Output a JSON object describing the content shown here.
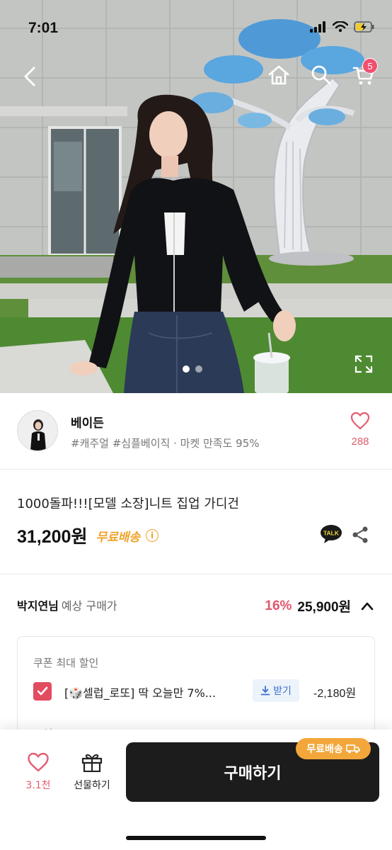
{
  "status_bar": {
    "time": "7:01"
  },
  "header": {
    "back_icon": "chevron-left-icon",
    "home_icon": "home-icon",
    "search_icon": "search-icon",
    "cart_icon": "cart-icon",
    "cart_badge": "5"
  },
  "hero": {
    "slide_count": 2,
    "active_slide": 1,
    "expand_icon": "expand-icon"
  },
  "seller": {
    "name": "베이든",
    "meta": "#캐주얼 #심플베이직 · 마켓 만족도 95%",
    "like_count": "288"
  },
  "product": {
    "title": "1000돌파!!![모델 소장]니트 집업 가디건",
    "price": "31,200원",
    "free_shipping": "무료배송",
    "talk_icon": "talk-icon",
    "share_icon": "share-icon"
  },
  "expected": {
    "buyer_name": "박지연님",
    "label": "예상 구매가",
    "discount": "16%",
    "final_price": "25,900원"
  },
  "coupon": {
    "heading": "쿠폰 최대 할인",
    "name": "[🎲셀럽_로또] 딱 오늘만 7%...",
    "get_label": "받기",
    "amount": "-2,180원",
    "point_heading": "포인트"
  },
  "bottom_bar": {
    "like_count": "3.1천",
    "gift_label": "선물하기",
    "buy_label": "구매하기",
    "ship_tag": "무료배송"
  },
  "colors": {
    "accent_pink": "#e25e71",
    "free_ship_orange": "#f0a229",
    "buy_button": "#1c1c1c",
    "coupon_blue": "#3b6fd2"
  }
}
